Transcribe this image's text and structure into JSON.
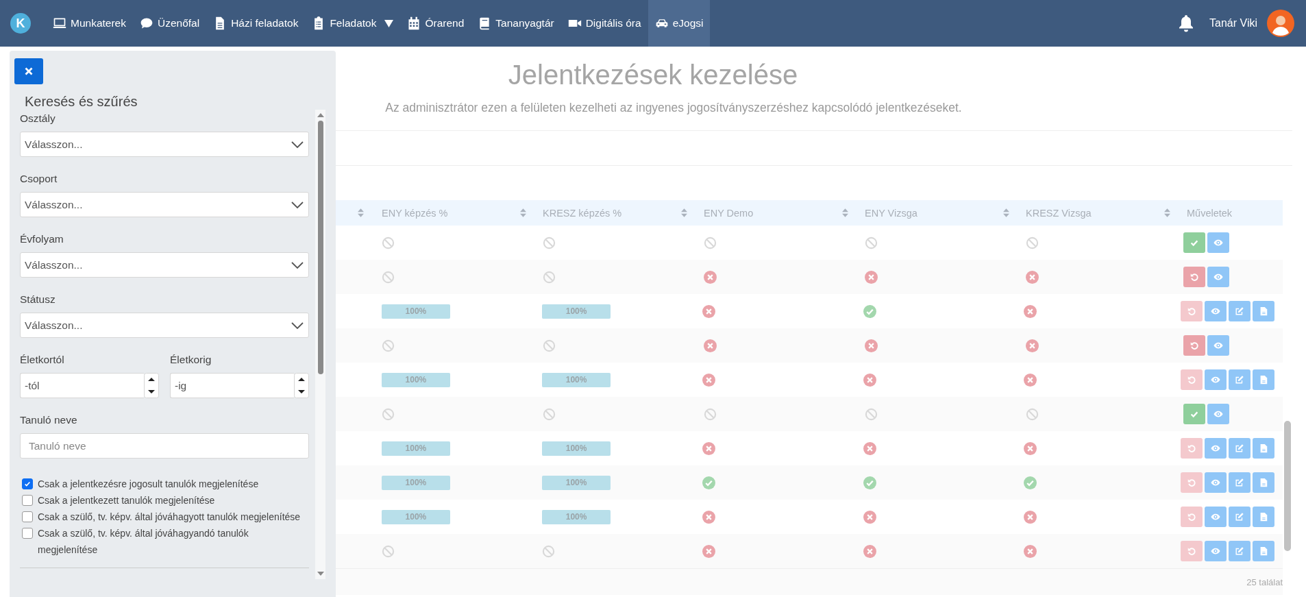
{
  "nav": {
    "logo_letter": "K",
    "items": [
      {
        "label": "Munkaterek",
        "kind": "monitor",
        "selected": false,
        "has_dropdown": false
      },
      {
        "label": "Üzenőfal",
        "kind": "chat",
        "selected": false,
        "has_dropdown": false
      },
      {
        "label": "Házi feladatok",
        "kind": "document",
        "selected": false,
        "has_dropdown": false
      },
      {
        "label": "Feladatok",
        "kind": "clipboard",
        "selected": false,
        "has_dropdown": true
      },
      {
        "label": "Órarend",
        "kind": "calendar",
        "selected": false,
        "has_dropdown": false
      },
      {
        "label": "Tananyagtár",
        "kind": "book",
        "selected": false,
        "has_dropdown": false
      },
      {
        "label": "Digitális óra",
        "kind": "video",
        "selected": false,
        "has_dropdown": false
      },
      {
        "label": "eJogsi",
        "kind": "car",
        "selected": true,
        "has_dropdown": false
      }
    ],
    "user": {
      "name": "Tanár Viki"
    }
  },
  "sidebar": {
    "title": "Keresés és szűrés",
    "selects": [
      {
        "label": "Osztály",
        "value": "Válasszon..."
      },
      {
        "label": "Csoport",
        "value": "Válasszon..."
      },
      {
        "label": "Évfolyam",
        "value": "Válasszon..."
      },
      {
        "label": "Státusz",
        "value": "Válasszon..."
      }
    ],
    "age_fields": [
      {
        "label": "Életkortól",
        "placeholder": "-tól"
      },
      {
        "label": "Életkorig",
        "placeholder": "-ig"
      }
    ],
    "name_field": {
      "label": "Tanuló neve",
      "placeholder": "Tanuló neve"
    },
    "checkboxes": [
      {
        "label": "Csak a jelentkezésre jogosult tanulók megjelenítése",
        "checked": true
      },
      {
        "label": "Csak a jelentkezett tanulók megjelenítése",
        "checked": false
      },
      {
        "label": "Csak a szülő, tv. képv. által jóváhagyott tanulók megjelenítése",
        "checked": false
      },
      {
        "label": "Csak a szülő, tv. képv. által jóváhagyandó tanulók megjelenítése",
        "checked": false
      }
    ]
  },
  "main": {
    "title": "Jelentkezések kezelése",
    "subtitle": "Az adminisztrátor ezen a felületen kezelheti az ingyenes jogosítványszerzéshez kapcsolódó jelentkezéseket.",
    "table": {
      "columns": [
        {
          "sortable": true
        },
        {
          "label": "ENY képzés %",
          "sortable": true
        },
        {
          "label": "KRESZ képzés %",
          "sortable": true
        },
        {
          "label": "ENY Demo",
          "sortable": true
        },
        {
          "label": "ENY Vizsga",
          "sortable": true
        },
        {
          "label": "KRESZ Vizsga",
          "sortable": true
        },
        {
          "label": "Műveletek",
          "sortable": false
        }
      ],
      "rows": [
        {
          "cells": [
            "",
            {
              "kind": "none"
            },
            {
              "kind": "none"
            },
            {
              "kind": "none"
            },
            {
              "kind": "none"
            },
            {
              "kind": "none"
            }
          ],
          "actions": [
            {
              "kind": "approve",
              "disabled": false
            },
            {
              "kind": "view",
              "disabled": false
            }
          ]
        },
        {
          "cells": [
            "",
            {
              "kind": "none"
            },
            {
              "kind": "none"
            },
            {
              "kind": "fail"
            },
            {
              "kind": "fail"
            },
            {
              "kind": "fail"
            }
          ],
          "actions": [
            {
              "kind": "revoke",
              "disabled": false
            },
            {
              "kind": "view",
              "disabled": false
            }
          ]
        },
        {
          "cells": [
            "",
            {
              "kind": "progress",
              "label": "100%",
              "level": 1
            },
            {
              "kind": "progress",
              "label": "100%",
              "level": 1
            },
            {
              "kind": "fail"
            },
            {
              "kind": "pass"
            },
            {
              "kind": "fail"
            }
          ],
          "actions": [
            {
              "kind": "revoke",
              "disabled": true
            },
            {
              "kind": "view",
              "disabled": false
            },
            {
              "kind": "edit",
              "disabled": false
            },
            {
              "kind": "pdf",
              "disabled": false
            }
          ]
        },
        {
          "cells": [
            "",
            {
              "kind": "none"
            },
            {
              "kind": "none"
            },
            {
              "kind": "fail"
            },
            {
              "kind": "fail"
            },
            {
              "kind": "fail"
            }
          ],
          "actions": [
            {
              "kind": "revoke",
              "disabled": false
            },
            {
              "kind": "view",
              "disabled": false
            }
          ]
        },
        {
          "cells": [
            "",
            {
              "kind": "progress",
              "label": "100%",
              "level": 1
            },
            {
              "kind": "progress",
              "label": "100%",
              "level": 1
            },
            {
              "kind": "fail"
            },
            {
              "kind": "fail"
            },
            {
              "kind": "fail"
            }
          ],
          "actions": [
            {
              "kind": "revoke",
              "disabled": true
            },
            {
              "kind": "view",
              "disabled": false
            },
            {
              "kind": "edit",
              "disabled": false
            },
            {
              "kind": "pdf",
              "disabled": false
            }
          ]
        },
        {
          "cells": [
            "",
            {
              "kind": "none"
            },
            {
              "kind": "none"
            },
            {
              "kind": "none"
            },
            {
              "kind": "none"
            },
            {
              "kind": "none"
            }
          ],
          "actions": [
            {
              "kind": "approve",
              "disabled": false
            },
            {
              "kind": "view",
              "disabled": false
            }
          ]
        },
        {
          "cells": [
            "",
            {
              "kind": "progress",
              "label": "100%",
              "level": 1
            },
            {
              "kind": "progress",
              "label": "100%",
              "level": 1
            },
            {
              "kind": "fail"
            },
            {
              "kind": "fail"
            },
            {
              "kind": "fail"
            }
          ],
          "actions": [
            {
              "kind": "revoke",
              "disabled": true
            },
            {
              "kind": "view",
              "disabled": false
            },
            {
              "kind": "edit",
              "disabled": false
            },
            {
              "kind": "pdf",
              "disabled": false
            }
          ]
        },
        {
          "cells": [
            "",
            {
              "kind": "progress",
              "label": "100%",
              "level": 1
            },
            {
              "kind": "progress",
              "label": "100%",
              "level": 1
            },
            {
              "kind": "pass"
            },
            {
              "kind": "pass"
            },
            {
              "kind": "pass"
            }
          ],
          "actions": [
            {
              "kind": "revoke",
              "disabled": true
            },
            {
              "kind": "view",
              "disabled": false
            },
            {
              "kind": "edit",
              "disabled": false
            },
            {
              "kind": "pdf",
              "disabled": false
            }
          ]
        },
        {
          "cells": [
            "",
            {
              "kind": "progress",
              "label": "100%",
              "level": 1
            },
            {
              "kind": "progress",
              "label": "100%",
              "level": 1
            },
            {
              "kind": "fail"
            },
            {
              "kind": "fail"
            },
            {
              "kind": "fail"
            }
          ],
          "actions": [
            {
              "kind": "revoke",
              "disabled": true
            },
            {
              "kind": "view",
              "disabled": false
            },
            {
              "kind": "edit",
              "disabled": false
            },
            {
              "kind": "pdf",
              "disabled": false
            }
          ]
        },
        {
          "cells": [
            "",
            {
              "kind": "none"
            },
            {
              "kind": "none"
            },
            {
              "kind": "fail"
            },
            {
              "kind": "fail"
            },
            {
              "kind": "fail"
            }
          ],
          "actions": [
            {
              "kind": "revoke",
              "disabled": true
            },
            {
              "kind": "view",
              "disabled": false
            },
            {
              "kind": "edit",
              "disabled": false
            },
            {
              "kind": "pdf",
              "disabled": false
            }
          ]
        }
      ],
      "result_count": "25 találat"
    }
  }
}
